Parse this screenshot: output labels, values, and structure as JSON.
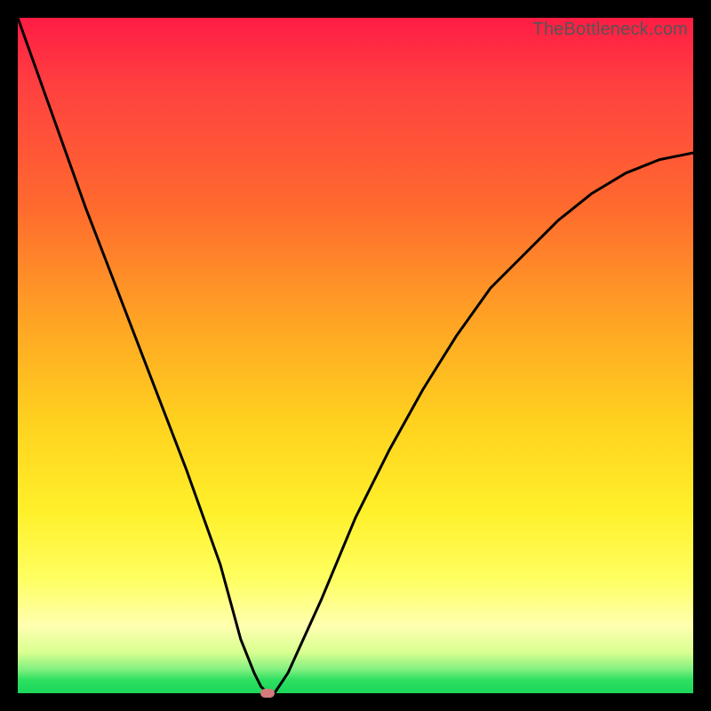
{
  "watermark": "TheBottleneck.com",
  "chart_data": {
    "type": "line",
    "title": "",
    "xlabel": "",
    "ylabel": "",
    "xlim": [
      0,
      100
    ],
    "ylim": [
      0,
      100
    ],
    "grid": false,
    "legend": false,
    "series": [
      {
        "name": "bottleneck-curve",
        "x": [
          0,
          5,
          10,
          15,
          20,
          25,
          30,
          33,
          35,
          36,
          37,
          38,
          40,
          45,
          50,
          55,
          60,
          65,
          70,
          75,
          80,
          85,
          90,
          95,
          100
        ],
        "values": [
          100,
          86,
          72,
          59,
          46,
          33,
          19,
          8,
          3,
          1,
          0,
          0,
          3,
          14,
          26,
          36,
          45,
          53,
          60,
          65,
          70,
          74,
          77,
          79,
          80
        ]
      }
    ],
    "marker": {
      "x": 37,
      "y": 0,
      "name": "optimal-point"
    }
  },
  "colors": {
    "curve": "#000000",
    "marker": "#d47a7a"
  }
}
